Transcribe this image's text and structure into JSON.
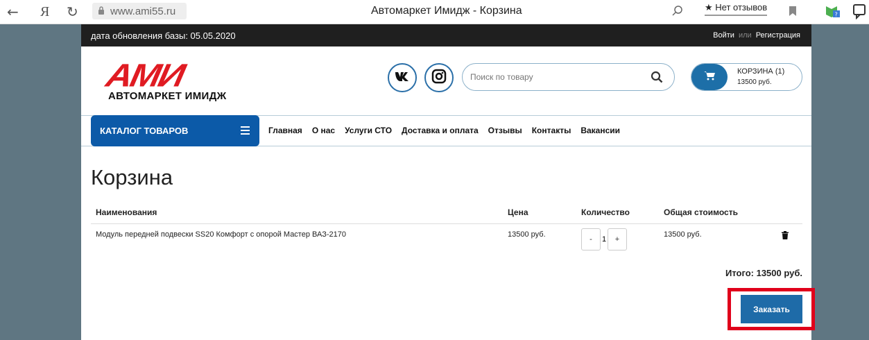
{
  "browser": {
    "back_glyph": "←",
    "yandex_glyph": "Я",
    "reload_glyph": "↻",
    "url": "www.ami55.ru",
    "tab_title": "Автомаркет Имидж - Корзина",
    "reviews_label": "★ Нет отзывов"
  },
  "topbar": {
    "update_text": "дата обновления базы: 05.05.2020",
    "login_label": "Войти",
    "or_label": "или",
    "register_label": "Регистрация"
  },
  "header": {
    "logo_main": "АМИ",
    "logo_sub": "АВТОМАРКЕТ ИМИДЖ",
    "search_placeholder": "Поиск по товару",
    "cart_title": "КОРЗИНА (1)",
    "cart_sum": "13500 руб."
  },
  "nav": {
    "catalog_label": "КАТАЛОГ ТОВАРОВ",
    "links": [
      "Главная",
      "О нас",
      "Услуги СТО",
      "Доставка и оплата",
      "Отзывы",
      "Контакты",
      "Вакансии"
    ]
  },
  "page": {
    "title": "Корзина"
  },
  "cart_table": {
    "headers": {
      "name": "Наименования",
      "price": "Цена",
      "qty": "Количество",
      "total": "Общая стоимость"
    },
    "rows": [
      {
        "name": "Модуль передней подвески SS20 Комфорт с опорой Мастер ВАЗ-2170",
        "price": "13500 руб.",
        "qty_minus": "-",
        "qty": "1",
        "qty_plus": "+",
        "total": "13500 руб."
      }
    ],
    "grand_total": "Итого: 13500 руб.",
    "order_label": "Заказать"
  },
  "colors": {
    "brand_blue": "#0c5aa8",
    "button_blue": "#1e6ba8",
    "logo_red": "#e01b22",
    "highlight_red": "#e0001b",
    "topbar_bg": "#1f1f1f"
  }
}
